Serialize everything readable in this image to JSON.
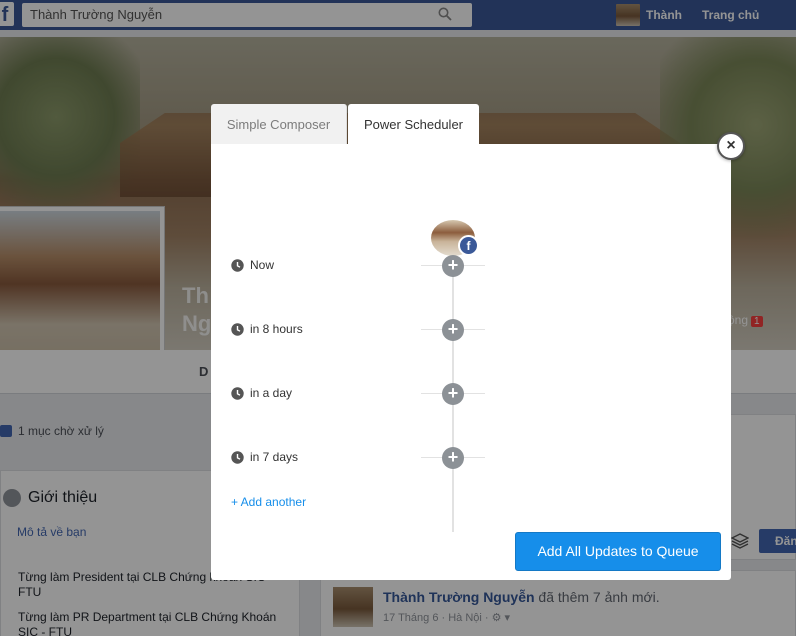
{
  "fb": {
    "search_value": "Thành Trường Nguyễn",
    "user_name": "Thành",
    "home_label": "Trang chủ",
    "profile_name": "Th\nNg",
    "cover_tab_label": "ộng",
    "cover_tab_badge": "1",
    "timeline_tab_label": "D",
    "pending_label": "1 mục chờ xử lý",
    "intro": {
      "title": "Giới thiệu",
      "add_bio": "Mô tả về bạn",
      "work1": "Từng làm President tại CLB Chứng khoán SIC - FTU",
      "work2": "Từng làm PR Department tại CLB Chứng Khoán SIC - FTU"
    },
    "post_button": "Đăn",
    "post": {
      "author": "Thành Trường Nguyễn",
      "action": " đã thêm 7 ảnh mới.",
      "meta": "17 Tháng 6 · Hà Nội · ⚙ ▾"
    }
  },
  "dialog": {
    "tabs": [
      {
        "label": "Simple Composer",
        "active": false
      },
      {
        "label": "Power Scheduler",
        "active": true
      }
    ],
    "close_label": "×",
    "avatar_badge": "f",
    "slots": [
      {
        "label": "Now"
      },
      {
        "label": "in 8 hours"
      },
      {
        "label": "in a day"
      },
      {
        "label": "in 7 days"
      }
    ],
    "plus_label": "+",
    "add_another": "+ Add another",
    "queue_button": "Add All Updates to Queue"
  },
  "colors": {
    "fb_blue": "#3b5998",
    "buffer_blue": "#168eea",
    "plus_gray": "#8c9196",
    "overlay": "rgba(0,0,0,0.42)"
  },
  "icons": {
    "search": "search-icon",
    "clock": "clock-icon",
    "close": "close-icon",
    "plus": "plus-icon",
    "facebook": "facebook-icon",
    "layers": "layers-icon"
  }
}
